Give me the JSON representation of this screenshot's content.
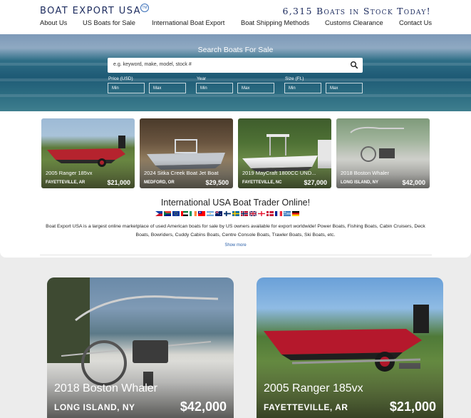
{
  "header": {
    "logo": "BOAT EXPORT USA",
    "logo_badge": "TM",
    "stock_banner": "6,315 Boats in Stock Today!",
    "nav": [
      {
        "label": "About Us"
      },
      {
        "label": "US Boats for Sale"
      },
      {
        "label": "International Boat Export"
      },
      {
        "label": "Boat Shipping Methods"
      },
      {
        "label": "Customs Clearance"
      },
      {
        "label": "Contact Us"
      }
    ]
  },
  "search": {
    "title": "Search Boats For Sale",
    "placeholder": "e.g. keyword, make, model, stock #",
    "icon": "search-icon",
    "filters": [
      {
        "label": "Price (USD)",
        "min": "Min",
        "max": "Max"
      },
      {
        "label": "Year",
        "min": "Min",
        "max": "Max"
      },
      {
        "label": "Size (Ft.)",
        "min": "Min",
        "max": "Max"
      }
    ]
  },
  "featured": [
    {
      "title": "2005 Ranger 185vx",
      "location": "FAYETTEVILLE, AR",
      "price": "$21,000"
    },
    {
      "title": "2024 Sitka Creek Boat Jet Boat",
      "location": "MEDFORD, OR",
      "price": "$29,500"
    },
    {
      "title": "2019 MayCraft 1800CC UND...",
      "location": "FAYETTEVILLE, NC",
      "price": "$27,000"
    },
    {
      "title": "2018 Boston Whaler",
      "location": "LONG ISLAND, NY",
      "price": "$42,000"
    }
  ],
  "intro": {
    "title": "International USA Boat Trader Online!",
    "flags": [
      "philippines-flag",
      "south-africa-flag",
      "eu-flag",
      "uae-flag",
      "ireland-flag",
      "taiwan-flag",
      "argentina-flag",
      "australia-flag",
      "finland-flag",
      "sweden-flag",
      "norway-flag",
      "uk-flag",
      "georgia-flag",
      "denmark-flag",
      "france-flag",
      "greece-flag",
      "germany-flag"
    ],
    "description": "Boat Export USA is a largest online marketplace of used American boats for sale by US owners available for export worldwide! Power Boats, Fishing Boats, Cabin Cruisers, Deck Boats, Bowriders, Cuddy Cabins Boats, Centre Console Boats, Trawler Boats, Ski Boats, etc.",
    "show_more": "Show more"
  },
  "listings": [
    {
      "title": "2018 Boston Whaler",
      "location": "LONG ISLAND, NY",
      "price": "$42,000"
    },
    {
      "title": "2005 Ranger 185vx",
      "location": "FAYETTEVILLE, AR",
      "price": "$21,000"
    }
  ],
  "colors": {
    "brand": "#1c2b5e",
    "link": "#2a5fa8"
  }
}
